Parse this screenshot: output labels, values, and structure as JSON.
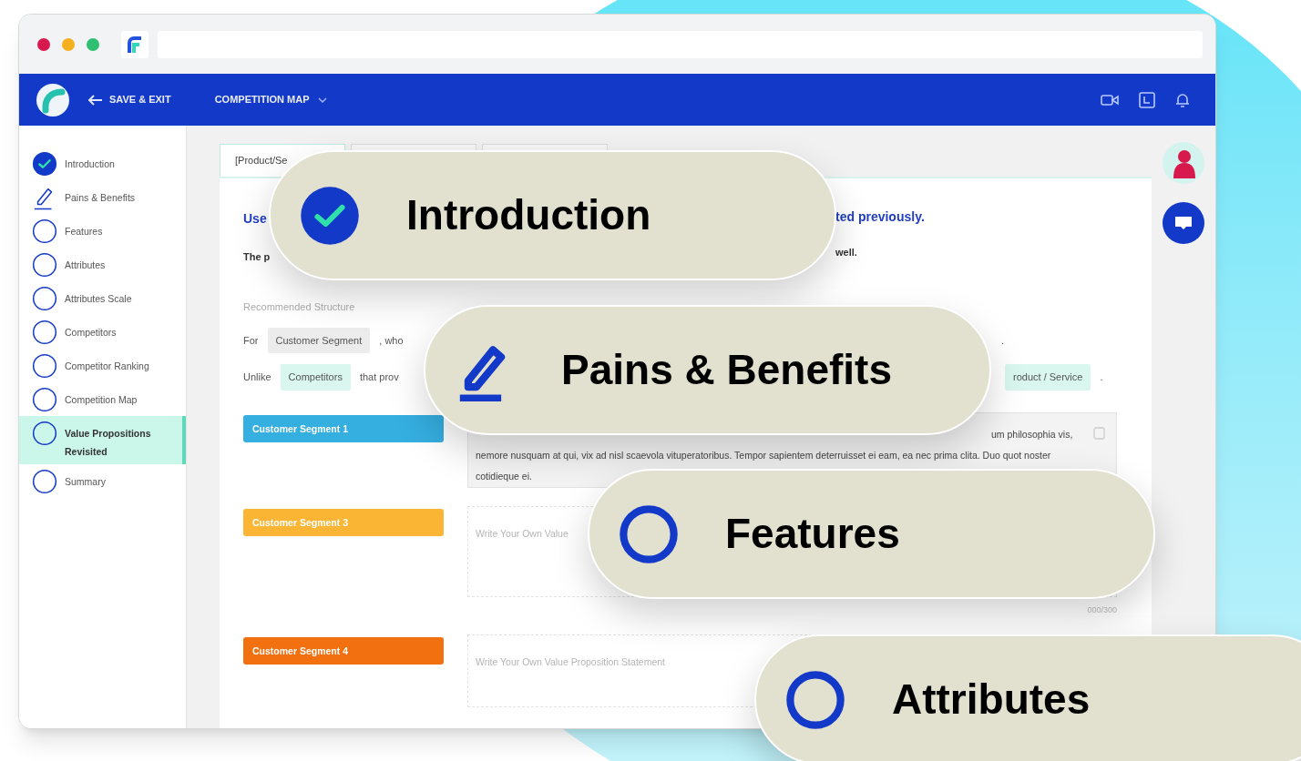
{
  "header": {
    "back_label": "SAVE & EXIT",
    "section": "COMPETITION MAP"
  },
  "sidebar": {
    "items": [
      {
        "label": "Introduction",
        "kind": "done",
        "selected": false
      },
      {
        "label": "Pains & Benefits",
        "kind": "editing",
        "selected": false
      },
      {
        "label": "Features",
        "kind": "open",
        "selected": false
      },
      {
        "label": "Attributes",
        "kind": "open",
        "selected": false
      },
      {
        "label": "Attributes Scale",
        "kind": "open",
        "selected": false
      },
      {
        "label": "Competitors",
        "kind": "open",
        "selected": false
      },
      {
        "label": "Competitor Ranking",
        "kind": "open",
        "selected": false
      },
      {
        "label": "Competition Map",
        "kind": "open",
        "selected": false
      },
      {
        "label": "Value Propositions Revisited",
        "kind": "open",
        "selected": true
      },
      {
        "label": "Summary",
        "kind": "open",
        "selected": false
      }
    ]
  },
  "tabs": [
    {
      "label": "[Product/Se",
      "selected": true
    },
    {
      "selected": false
    },
    {
      "selected": false
    }
  ],
  "card": {
    "heading": [
      "Use",
      "ted previously."
    ],
    "intro": [
      "The p",
      "well."
    ],
    "structure_title": "Recommended Structure",
    "structure_rows": [
      {
        "left": [
          {
            "text": "For",
            "kind": "word"
          },
          {
            "text": "Customer Segment",
            "kind": "chip",
            "color": "#ececec"
          },
          {
            "text": ", who",
            "kind": "word"
          }
        ],
        "right": [
          {
            "text": ".",
            "kind": "word"
          }
        ]
      },
      {
        "left": [
          {
            "text": "Unlike",
            "kind": "word"
          },
          {
            "text": "Competitors",
            "kind": "chip",
            "color": "#d9f7ee"
          },
          {
            "text": "that prov",
            "kind": "word"
          }
        ],
        "right": [
          {
            "text": "roduct / Service",
            "kind": "chip",
            "color": "#d9f7ee"
          },
          {
            "text": ".",
            "kind": "word"
          }
        ]
      }
    ],
    "segments": [
      {
        "label": "Customer Segment 1",
        "color": "#35aee0",
        "statement_fragment": "um philosophia vis,",
        "statement": "nemore nusquam at qui, vix ad nisl scaevola vituperatoribus. Tempor sapientem deterruisset ei eam, ea nec prima clita. Duo quot noster cotidieque ei."
      },
      {
        "label": "Customer Segment 3",
        "color": "#f9b533",
        "placeholder": "Write Your Own Value",
        "counter": "000/300"
      },
      {
        "label": "Customer Segment 4",
        "color": "#f2700f",
        "placeholder": "Write Your Own Value Proposition Statement"
      }
    ]
  },
  "highlights": [
    {
      "label": "Introduction",
      "kind": "done"
    },
    {
      "label": "Pains & Benefits",
      "kind": "editing"
    },
    {
      "label": "Features",
      "kind": "open"
    },
    {
      "label": "Attributes",
      "kind": "open"
    }
  ]
}
